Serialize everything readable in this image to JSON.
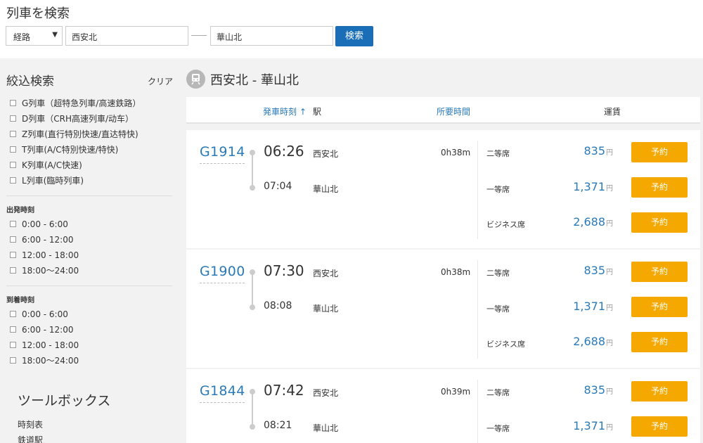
{
  "search": {
    "title": "列車を検索",
    "route_type": "経路",
    "caret": "▼",
    "from": "西安北",
    "to": "華山北",
    "button": "検索"
  },
  "sidebar": {
    "title": "絞込検索",
    "clear": "クリア",
    "train_types": [
      "G列車（超特急列車/高速鉄路）",
      "D列車（CRH高速列車/动车）",
      "Z列車(直行特別快速/直达特快)",
      "T列車(A/C特別快速/特快)",
      "K列車(A/C快速)",
      "L列車(臨時列車)"
    ],
    "departure_head": "出発時刻",
    "departure_times": [
      "0:00 - 6:00",
      "6:00 - 12:00",
      "12:00 - 18:00",
      "18:00～24:00"
    ],
    "arrival_head": "到着時刻",
    "arrival_times": [
      "0:00 - 6:00",
      "6:00 - 12:00",
      "12:00 - 18:00",
      "18:00～24:00"
    ],
    "toolbox_title": "ツールボックス",
    "toolbox_links": [
      "時刻表",
      "鉄道駅"
    ]
  },
  "main": {
    "route_title": "西安北 - 華山北",
    "columns": {
      "departure": "発車時刻 ↑",
      "station": "駅",
      "duration": "所要時間",
      "fare": "運賃"
    },
    "yen": "円",
    "book_label": "予約",
    "trains": [
      {
        "number": "G1914",
        "dep_time": "06:26",
        "arr_time": "07:04",
        "dep_station": "西安北",
        "arr_station": "華山北",
        "duration": "0h38m",
        "fares": [
          {
            "seat": "二等席",
            "price": "835"
          },
          {
            "seat": "一等席",
            "price": "1,371"
          },
          {
            "seat": "ビジネス席",
            "price": "2,688"
          }
        ]
      },
      {
        "number": "G1900",
        "dep_time": "07:30",
        "arr_time": "08:08",
        "dep_station": "西安北",
        "arr_station": "華山北",
        "duration": "0h38m",
        "fares": [
          {
            "seat": "二等席",
            "price": "835"
          },
          {
            "seat": "一等席",
            "price": "1,371"
          },
          {
            "seat": "ビジネス席",
            "price": "2,688"
          }
        ]
      },
      {
        "number": "G1844",
        "dep_time": "07:42",
        "arr_time": "08:21",
        "dep_station": "西安北",
        "arr_station": "華山北",
        "duration": "0h39m",
        "fares": [
          {
            "seat": "二等席",
            "price": "835"
          },
          {
            "seat": "一等席",
            "price": "1,371"
          }
        ]
      }
    ]
  }
}
